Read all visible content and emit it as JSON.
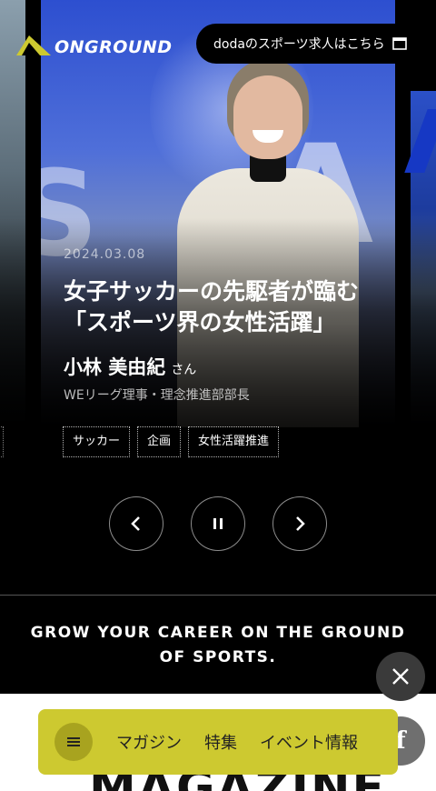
{
  "header": {
    "logo_text": "ONGROUND",
    "doda_button_label": "dodaのスポーツ求人はこちら"
  },
  "slide": {
    "date": "2024.03.08",
    "title": "女子サッカーの先駆者が臨む「スポーツ界の女性活躍」",
    "person_name": "小林 美由紀",
    "honorific": "さん",
    "role": "WEリーグ理事・理念推進部部長",
    "tags": [
      "サッカー",
      "企画",
      "女性活躍推進"
    ]
  },
  "controls": {
    "prev_icon": "chevron-left-icon",
    "pause_icon": "pause-icon",
    "next_icon": "chevron-right-icon"
  },
  "tagline": "GROW YOUR CAREER ON THE GROUND OF SPORTS.",
  "section_heading": "MAGAZINE",
  "social": {
    "x_icon": "x-logo-icon",
    "facebook_icon": "facebook-icon"
  },
  "bottom_nav": {
    "menu_icon": "hamburger-menu-icon",
    "items": [
      "マガジン",
      "特集",
      "イベント情報"
    ]
  },
  "colors": {
    "accent_yellow": "#cdc930",
    "background": "#000000"
  }
}
